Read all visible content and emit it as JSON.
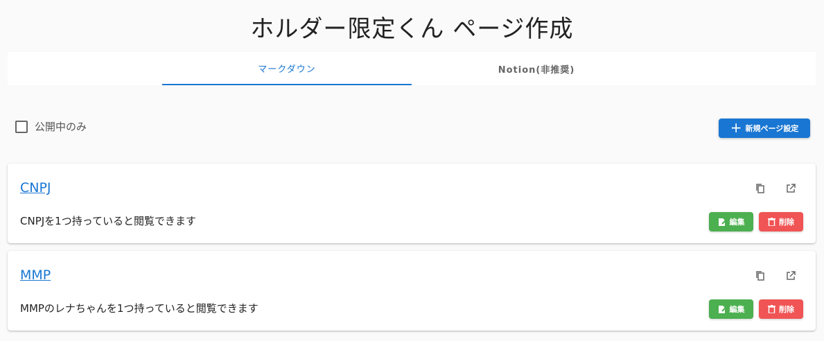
{
  "page": {
    "title": "ホルダー限定くん ページ作成"
  },
  "tabs": [
    {
      "label": "マークダウン",
      "active": true
    },
    {
      "label": "Notion(非推奨)",
      "active": false
    }
  ],
  "filter": {
    "label": "公開中のみ",
    "checked": false
  },
  "new_button": {
    "label": "新規ページ設定",
    "icon": "plus-icon"
  },
  "cards": [
    {
      "title": "CNPJ",
      "description": "CNPJを1つ持っていると閲覧できます",
      "edit_label": "編集",
      "delete_label": "削除"
    },
    {
      "title": "MMP",
      "description": "MMPのレナちゃんを1つ持っていると閲覧できます",
      "edit_label": "編集",
      "delete_label": "削除"
    }
  ],
  "colors": {
    "primary": "#1976d2",
    "edit": "#4caf50",
    "delete": "#f05454"
  }
}
